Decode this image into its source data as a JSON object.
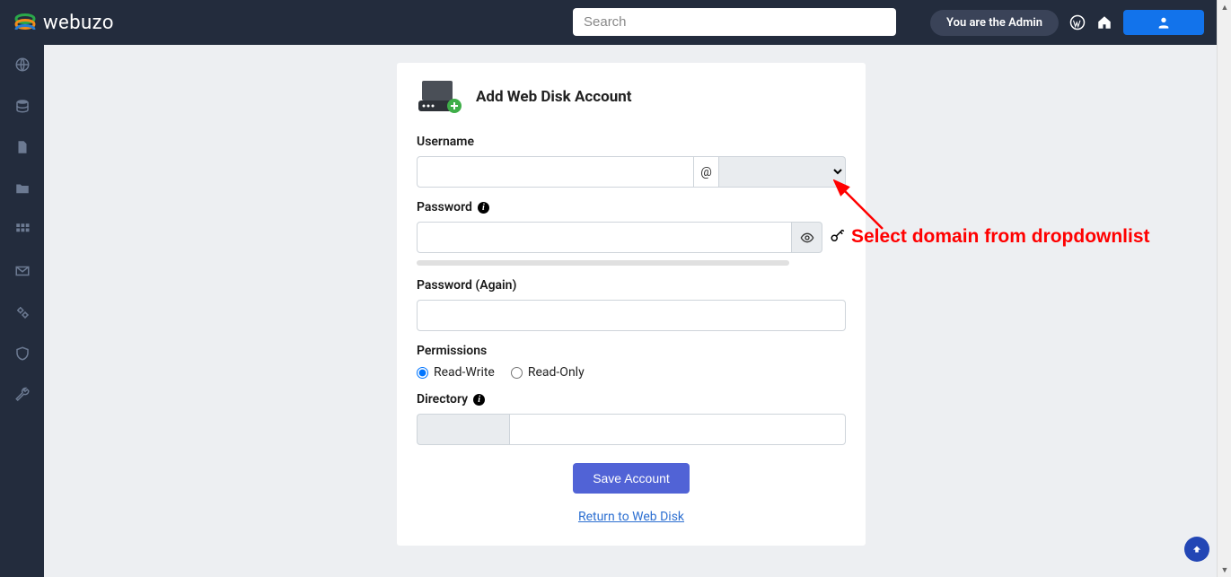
{
  "brand": "webuzo",
  "search": {
    "placeholder": "Search"
  },
  "top": {
    "admin_label": "You are the Admin"
  },
  "card": {
    "title": "Add Web Disk Account",
    "username_label": "Username",
    "at_symbol": "@",
    "domain_selected": "",
    "password_label": "Password",
    "password_again_label": "Password (Again)",
    "permissions_label": "Permissions",
    "perm_rw": "Read-Write",
    "perm_ro": "Read-Only",
    "directory_label": "Directory",
    "save_label": "Save Account",
    "return_label": "Return to Web Disk"
  },
  "annotation": {
    "text": "Select domain from dropdownlist"
  }
}
